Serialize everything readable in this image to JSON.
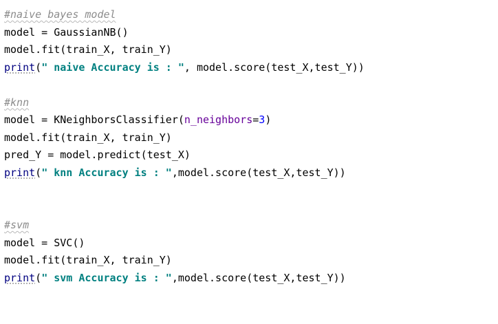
{
  "code": {
    "block1": {
      "comment": "#naive bayes model",
      "line1_var": "model",
      "line1_op": " = ",
      "line1_call": "GaussianNB()",
      "line2": "model.fit(train_X, train_Y)",
      "line3_builtin": "print",
      "line3_open": "(",
      "line3_str": "\" naive Accuracy is : \"",
      "line3_rest": ", model.score(test_X,test_Y))"
    },
    "block2": {
      "comment": "#knn",
      "line1_var": "model",
      "line1_op": " = ",
      "line1_call": "KNeighborsClassifier(",
      "line1_kwarg": "n_neighbors",
      "line1_eq": "=",
      "line1_num": "3",
      "line1_close": ")",
      "line2": "model.fit(train_X, train_Y)",
      "line3": "pred_Y = model.predict(test_X)",
      "line4_builtin": "print",
      "line4_open": "(",
      "line4_str": "\" knn Accuracy is : \"",
      "line4_rest": ",model.score(test_X,test_Y))"
    },
    "block3": {
      "comment": "#svm",
      "line1_var": "model",
      "line1_op": " = ",
      "line1_call": "SVC()",
      "line2": "model.fit(train_X, train_Y)",
      "line3_builtin": "print",
      "line3_open": "(",
      "line3_str": "\" svm Accuracy is : \"",
      "line3_rest": ",model.score(test_X,test_Y))"
    }
  }
}
